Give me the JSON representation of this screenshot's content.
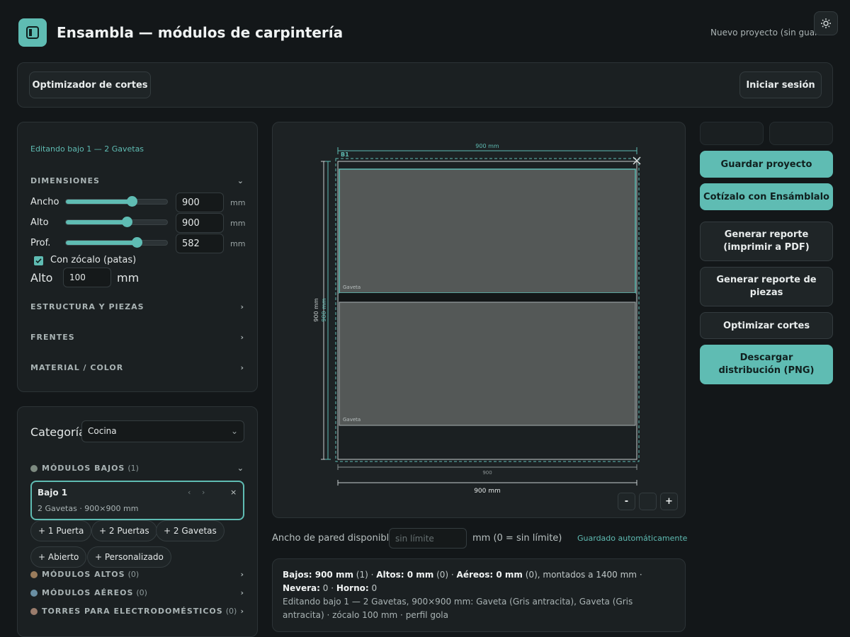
{
  "app": {
    "title": "Ensambla — módulos de carpintería",
    "project_status": "Nuevo proyecto (sin guardar)"
  },
  "toolbar": {
    "cut_optimizer": "Optimizador de cortes",
    "login": "Iniciar sesión"
  },
  "editor": {
    "heading": "Editando bajo 1 — 2 Gavetas",
    "dimensions": {
      "title": "DIMENSIONES",
      "rows": [
        {
          "label": "Ancho",
          "value": "900",
          "unit": "mm",
          "level": 0.65
        },
        {
          "label": "Alto",
          "value": "900",
          "unit": "mm",
          "level": 0.6
        },
        {
          "label": "Prof.",
          "value": "582",
          "unit": "mm",
          "level": 0.7
        }
      ],
      "plinth_label": "Con zócalo (patas)",
      "plinth_height_label": "Alto",
      "plinth_height_value": "100",
      "plinth_unit": "mm"
    },
    "sections": [
      "ESTRUCTURA Y PIEZAS",
      "FRENTES",
      "MATERIAL / COLOR"
    ]
  },
  "catalog": {
    "category_label": "Categoría",
    "category_value": "Cocina",
    "low": {
      "name": "MÓDULOS BAJOS",
      "count": "(1)",
      "color": "#7d8a80"
    },
    "module": {
      "name": "Bajo 1",
      "desc": "2 Gavetas · 900×900 mm"
    },
    "add_buttons": [
      "+ 1 Puerta",
      "+ 2 Puertas",
      "+ 2 Gavetas",
      "+ Abierto",
      "+ Personalizado"
    ],
    "others": [
      {
        "name": "MÓDULOS ALTOS",
        "count": "(0)",
        "color": "#9a7c5c"
      },
      {
        "name": "MÓDULOS AÉREOS",
        "count": "(0)",
        "color": "#6a8fa3"
      },
      {
        "name": "TORRES PARA ELECTRODOMÉSTICOS",
        "count": "(0)",
        "color": "#9a7c6c"
      }
    ]
  },
  "canvas": {
    "top_dim": "900 mm",
    "module_tag": "B1",
    "drawer_label": "Gaveta",
    "left_dim_outer": "900 mm",
    "left_dim_inner": "900 mm",
    "bottom_dim_small": "900",
    "bottom_dim": "900 mm",
    "zoom_out": "-",
    "zoom_in": "+"
  },
  "wall": {
    "label": "Ancho de pared disponible",
    "placeholder": "sin límite",
    "hint": "mm (0 = sin límite)",
    "autosave": "Guardado automáticamente"
  },
  "summary": {
    "line1": [
      {
        "b": "Bajos: 900 mm",
        "t": " (1) · "
      },
      {
        "b": "Altos: 0 mm",
        "t": " (0) · "
      },
      {
        "b": "Aéreos: 0 mm",
        "t": " (0), montados a 1400 mm · "
      },
      {
        "b": "Nevera:",
        "t": " 0 · "
      },
      {
        "b": "Horno:",
        "t": " 0"
      }
    ],
    "line2": "Editando bajo 1 — 2 Gavetas, 900×900 mm: Gaveta (Gris antracita), Gaveta (Gris antracita) · zócalo 100 mm · perfil gola"
  },
  "actions": {
    "save": "Guardar proyecto",
    "quote": "Cotízalo con Ensámblalo",
    "report_pdf": "Generar reporte (imprimir a PDF)",
    "report_parts": "Generar reporte de piezas",
    "optimize": "Optimizar cortes",
    "download": "Descargar distribución (PNG)"
  },
  "colors": {
    "accent": "#5fbcb3",
    "drawer": "#545857"
  }
}
